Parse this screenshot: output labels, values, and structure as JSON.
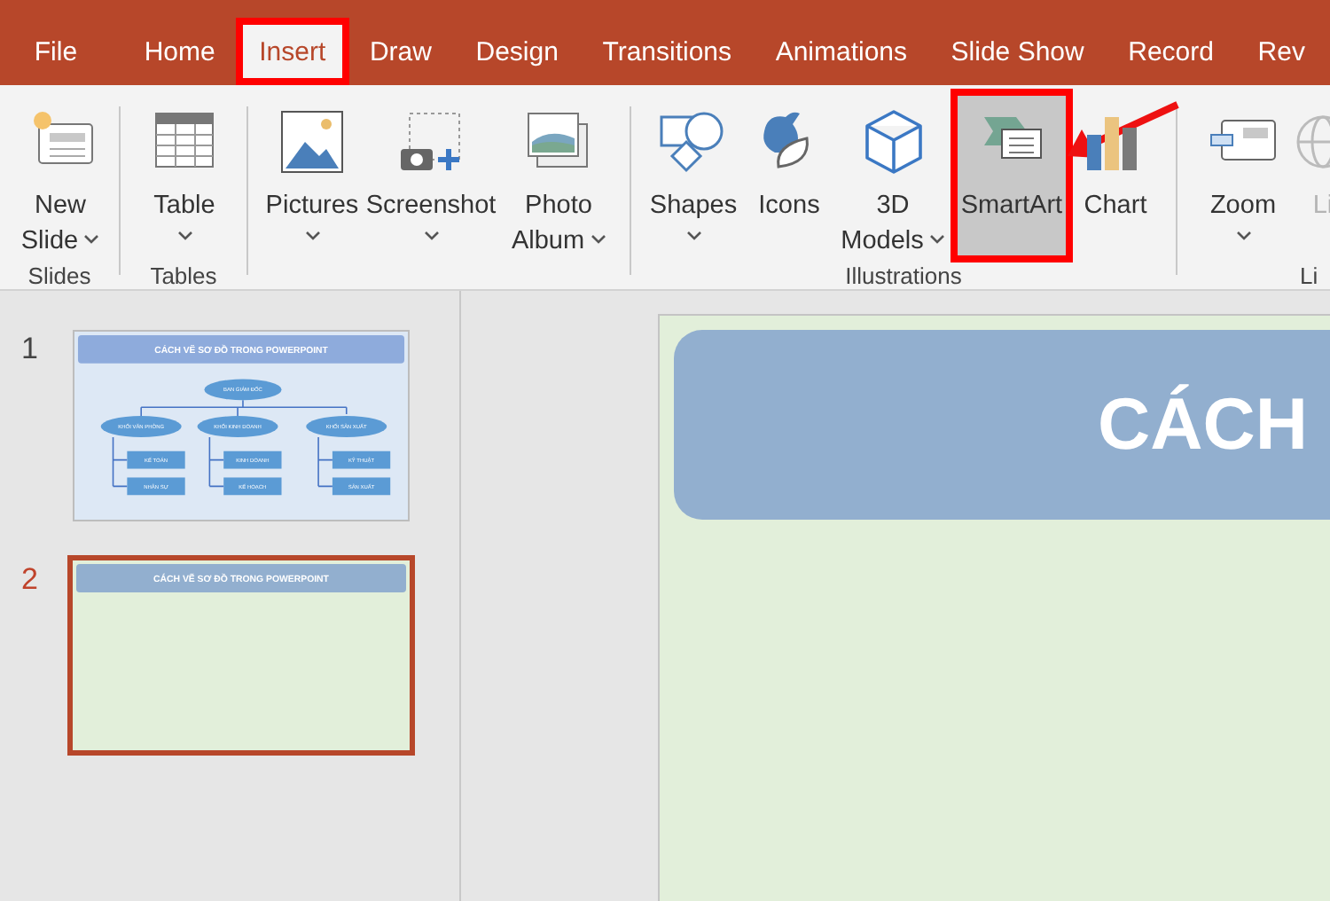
{
  "tabs": [
    {
      "label": "File",
      "selected": false,
      "marked": false
    },
    {
      "label": "Home",
      "selected": false,
      "marked": false
    },
    {
      "label": "Insert",
      "selected": true,
      "marked": true
    },
    {
      "label": "Draw",
      "selected": false,
      "marked": false
    },
    {
      "label": "Design",
      "selected": false,
      "marked": false
    },
    {
      "label": "Transitions",
      "selected": false,
      "marked": false
    },
    {
      "label": "Animations",
      "selected": false,
      "marked": false
    },
    {
      "label": "Slide Show",
      "selected": false,
      "marked": false
    },
    {
      "label": "Record",
      "selected": false,
      "marked": false
    },
    {
      "label": "Rev",
      "selected": false,
      "marked": false
    }
  ],
  "ribbon": {
    "groups": [
      {
        "label": "Slides",
        "buttons": [
          {
            "label": "New\nSlide",
            "dropdown": true,
            "disabled": false,
            "highlighted": false,
            "marked": false
          }
        ]
      },
      {
        "label": "Tables",
        "buttons": [
          {
            "label": "Table",
            "dropdown": true,
            "disabled": false,
            "highlighted": false,
            "marked": false
          }
        ]
      },
      {
        "buttons": [
          {
            "label": "Pictures",
            "dropdown": true,
            "disabled": false,
            "highlighted": false,
            "marked": false
          },
          {
            "label": "Screenshot",
            "dropdown": true,
            "disabled": false,
            "highlighted": false,
            "marked": false
          },
          {
            "label": "Photo\nAlbum",
            "dropdown": true,
            "disabled": false,
            "highlighted": false,
            "marked": false
          }
        ]
      },
      {
        "label": "Illustrations",
        "buttons": [
          {
            "label": "Shapes",
            "dropdown": true,
            "disabled": false,
            "highlighted": false,
            "marked": false
          },
          {
            "label": "Icons",
            "dropdown": false,
            "disabled": false,
            "highlighted": false,
            "marked": false
          },
          {
            "label": "3D\nModels",
            "dropdown": true,
            "disabled": false,
            "highlighted": false,
            "marked": false
          },
          {
            "label": "SmartArt",
            "dropdown": false,
            "disabled": false,
            "highlighted": true,
            "marked": true
          },
          {
            "label": "Chart",
            "dropdown": false,
            "disabled": false,
            "highlighted": false,
            "marked": false
          }
        ]
      },
      {
        "label": "Li",
        "buttons": [
          {
            "label": "Zoom",
            "dropdown": true,
            "disabled": false,
            "highlighted": false,
            "marked": false
          },
          {
            "label": "Li",
            "dropdown": false,
            "disabled": true,
            "highlighted": false,
            "marked": false
          }
        ]
      }
    ]
  },
  "slides": [
    {
      "number": "1",
      "selected": false,
      "title": "CÁCH VẼ SƠ ĐỒ TRONG POWERPOINT",
      "diagram": {
        "root": "BAN GIÁM ĐỐC",
        "branches": [
          {
            "label": "KHỐI VĂN PHÒNG",
            "children": [
              "KẾ TOÁN",
              "NHÂN SỰ"
            ]
          },
          {
            "label": "KHỐI KINH DOANH",
            "children": [
              "KINH DOANH",
              "KẾ HOẠCH"
            ]
          },
          {
            "label": "KHỐI SẢN XUẤT",
            "children": [
              "KỸ THUẬT",
              "SẢN XUẤT"
            ]
          }
        ]
      }
    },
    {
      "number": "2",
      "selected": true,
      "title": "CÁCH VẼ SƠ ĐỒ TRONG POWERPOINT"
    }
  ],
  "editor": {
    "title": "CÁCH"
  }
}
